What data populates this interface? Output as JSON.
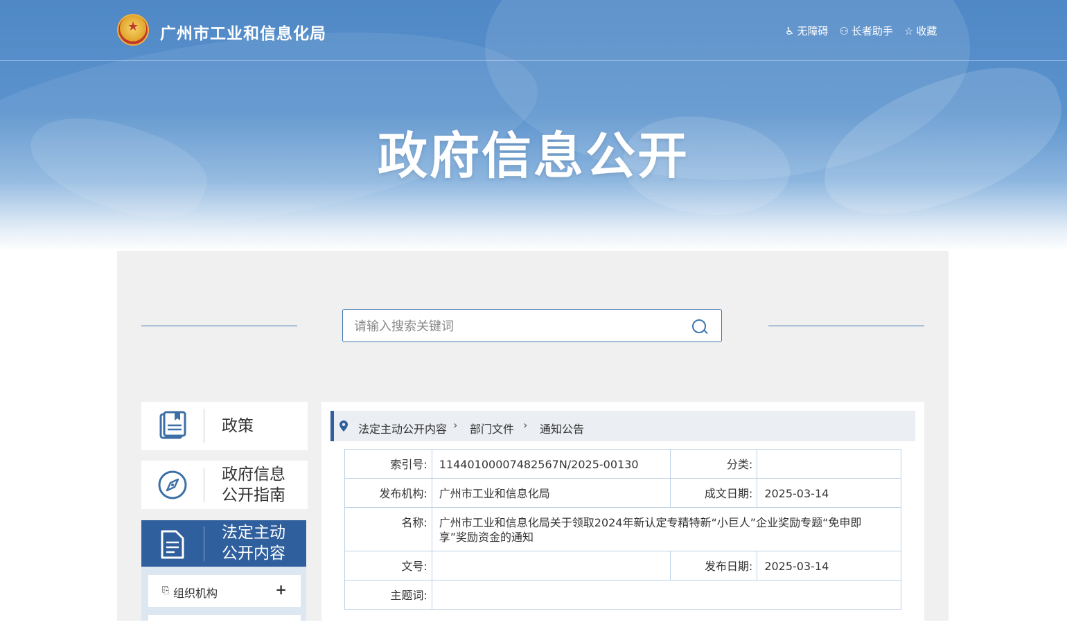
{
  "header": {
    "site_title": "广州市工业和信息化局",
    "emblem_glyph": "★",
    "tools": [
      {
        "icon": "accessibility-icon",
        "glyph": "♿",
        "label": "无障碍"
      },
      {
        "icon": "elder-helper-icon",
        "glyph": "⚇",
        "label": "长者助手"
      },
      {
        "icon": "star-icon",
        "glyph": "☆",
        "label": "收藏"
      }
    ]
  },
  "hero": {
    "title": "政府信息公开"
  },
  "search": {
    "placeholder": "请输入搜索关键词"
  },
  "sidebar": {
    "items": [
      {
        "icon": "policy-book-icon",
        "line1": "政策",
        "line2": ""
      },
      {
        "icon": "compass-icon",
        "line1": "政府信息",
        "line2": "公开指南"
      },
      {
        "icon": "document-icon",
        "line1": "法定主动",
        "line2": "公开内容"
      }
    ],
    "sub_items": [
      {
        "icon_glyph": "⎘",
        "label": "组织机构",
        "toggle": "+"
      }
    ]
  },
  "breadcrumb": [
    "法定主动公开内容",
    "部门文件",
    "通知公告"
  ],
  "breadcrumb_sep": "›",
  "meta": {
    "index_label": "索引号:",
    "index_value": "11440100007482567N/2025-00130",
    "category_label": "分类:",
    "category_value": "",
    "publisher_label": "发布机构:",
    "publisher_value": "广州市工业和信息化局",
    "written_date_label": "成文日期:",
    "written_date_value": "2025-03-14",
    "name_label": "名称:",
    "name_value": "广州市工业和信息化局关于领取2024年新认定专精特新“小巨人”企业奖励专题“免申即享”奖励资金的通知",
    "doc_no_label": "文号:",
    "doc_no_value": "",
    "publish_date_label": "发布日期:",
    "publish_date_value": "2025-03-14",
    "keywords_label": "主题词:",
    "keywords_value": ""
  }
}
